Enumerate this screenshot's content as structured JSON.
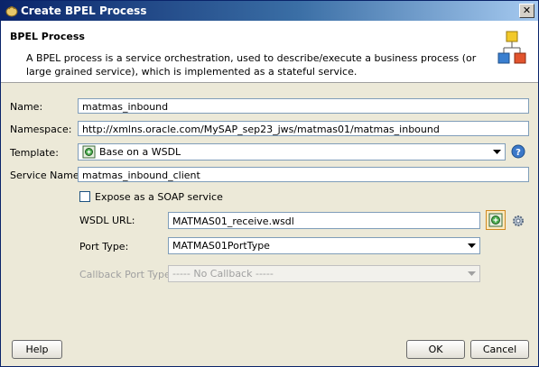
{
  "window": {
    "title": "Create BPEL Process",
    "close_glyph": "✕"
  },
  "header": {
    "title": "BPEL Process",
    "description": "A BPEL process is a service orchestration, used to describe/execute a business process (or large grained service), which is implemented as a stateful service."
  },
  "form": {
    "name_label": "Name:",
    "name_value": "matmas_inbound",
    "namespace_label": "Namespace:",
    "namespace_value": "http://xmlns.oracle.com/MySAP_sep23_jws/matmas01/matmas_inbound",
    "template_label": "Template:",
    "template_value": "Base on a WSDL",
    "service_name_label": "Service Name:",
    "service_name_value": "matmas_inbound_client",
    "expose_soap_label": "Expose as a SOAP service",
    "expose_soap_checked": false,
    "wsdl_url_label": "WSDL URL:",
    "wsdl_url_value": "MATMAS01_receive.wsdl",
    "port_type_label": "Port Type:",
    "port_type_value": "MATMAS01PortType",
    "callback_port_type_label": "Callback Port Type:",
    "callback_port_type_value": "----- No Callback -----"
  },
  "footer": {
    "help_label": "Help",
    "ok_label": "OK",
    "cancel_label": "Cancel"
  },
  "colors": {
    "titlebar": "#0a246a",
    "dialog_bg": "#ece9d8",
    "field_border": "#7f9db9"
  }
}
